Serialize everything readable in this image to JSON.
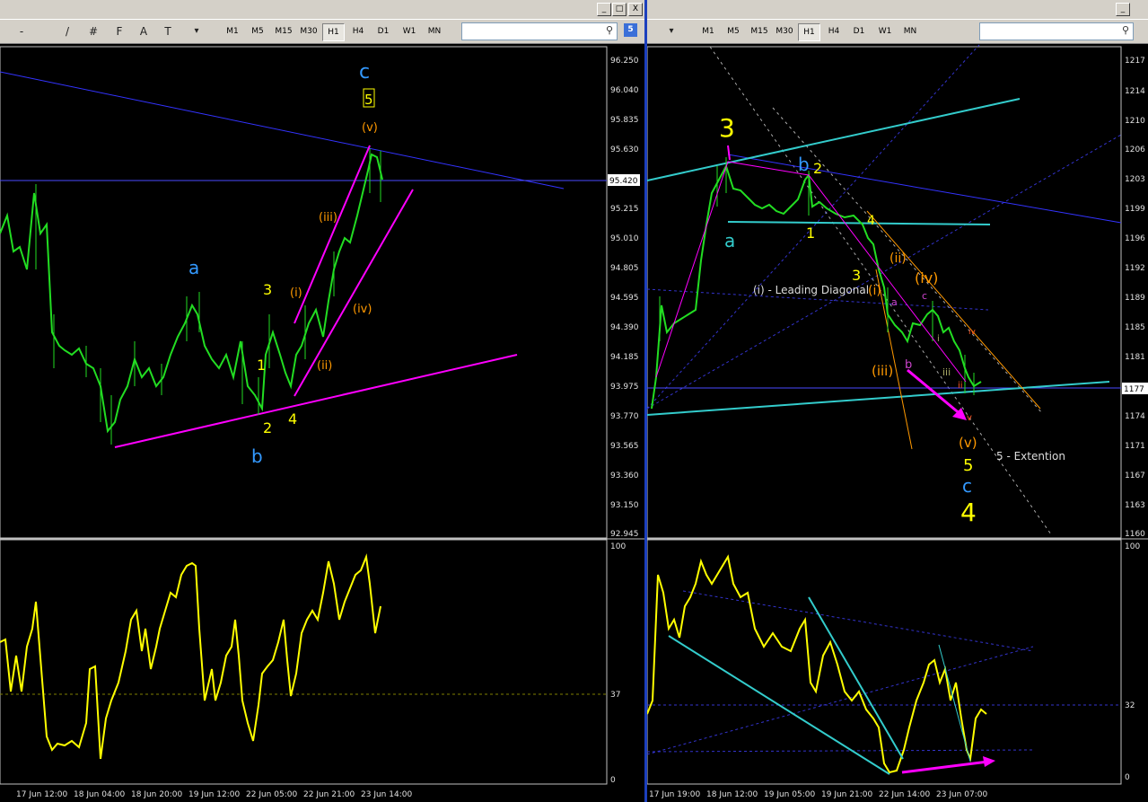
{
  "toolbar": {
    "timeframes": [
      "M1",
      "M5",
      "M15",
      "M30",
      "H1",
      "H4",
      "D1",
      "W1",
      "MN"
    ],
    "active_timeframe": "H1",
    "left_tools": [
      "-",
      "/",
      "#",
      "F",
      "A",
      "T",
      "shapes"
    ],
    "left_badge": "5",
    "caption_buttons": [
      "_",
      "□",
      "X"
    ]
  },
  "left_chart": {
    "price_axis": [
      "96.250",
      "96.040",
      "95.835",
      "95.630",
      "95.420",
      "95.215",
      "95.010",
      "94.805",
      "94.595",
      "94.390",
      "94.185",
      "93.975",
      "93.770",
      "93.565",
      "93.360",
      "93.150",
      "92.945"
    ],
    "current_price": "95.420",
    "time_axis": [
      "17 Jun 12:00",
      "18 Jun 04:00",
      "18 Jun 20:00",
      "19 Jun 12:00",
      "22 Jun 05:00",
      "22 Jun 21:00",
      "23 Jun 14:00"
    ],
    "osc_axis": [
      "100",
      "37",
      "0"
    ],
    "labels": {
      "c": "c",
      "five_boxed": "5",
      "v": "(v)",
      "iii": "(iii)",
      "i": "(i)",
      "iv": "(iv)",
      "ii": "(ii)",
      "a": "a",
      "three": "3",
      "one": "1",
      "two": "2",
      "four": "4",
      "b": "b"
    }
  },
  "right_chart": {
    "price_axis": [
      "1217",
      "1214",
      "1210",
      "1206",
      "1203",
      "1199",
      "1196",
      "1192",
      "1189",
      "1185",
      "1181",
      "1177",
      "1174",
      "1171",
      "1167",
      "1163",
      "1160"
    ],
    "current_price": "1177",
    "time_axis": [
      "17 Jun 19:00",
      "18 Jun 12:00",
      "19 Jun 05:00",
      "19 Jun 21:00",
      "22 Jun 14:00",
      "23 Jun 07:00"
    ],
    "osc_axis": [
      "100",
      "32",
      "0"
    ],
    "labels": {
      "three_big": "3",
      "a": "a",
      "b": "b",
      "two": "2",
      "one": "1",
      "four_small": "4",
      "three": "3",
      "ii": "(ii)",
      "iv": "(iv)",
      "i": "(i)",
      "leading": "(i) - Leading Diagonal",
      "iii": "(iii)",
      "v": "(v)",
      "five": "5",
      "c": "c",
      "four_big": "4",
      "extention": "5 - Extention",
      "small_a": "a",
      "small_b": "b",
      "small_c": "c",
      "small_iii": "iii",
      "small_ii": "ii",
      "small_iv": "iv",
      "small_i": "i",
      "small_v": "v"
    }
  },
  "colors": {
    "candle": "#22dd22",
    "trend_blue": "#3333ff",
    "magenta": "#ff00ff",
    "cyan": "#33cccc",
    "yellow": "#ffff00",
    "wave_blue": "#3399ff",
    "orange": "#ff9900"
  }
}
